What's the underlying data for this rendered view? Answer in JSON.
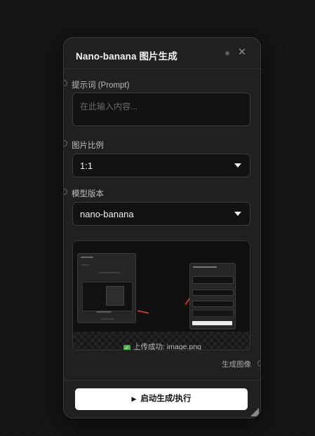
{
  "node": {
    "title": "Nano-banana 图片生成",
    "close_icon": "close-icon"
  },
  "fields": {
    "prompt_label": "提示词 (Prompt)",
    "prompt_placeholder": "在此输入内容...",
    "prompt_value": "",
    "ratio_label": "图片比例",
    "ratio_value": "1:1",
    "model_label": "模型版本",
    "model_value": "nano-banana"
  },
  "upload": {
    "status_text": "上传成功: image.png"
  },
  "output": {
    "label": "生成图像"
  },
  "footer": {
    "run_label": "启动生成/执行",
    "run_icon": "play-icon"
  }
}
